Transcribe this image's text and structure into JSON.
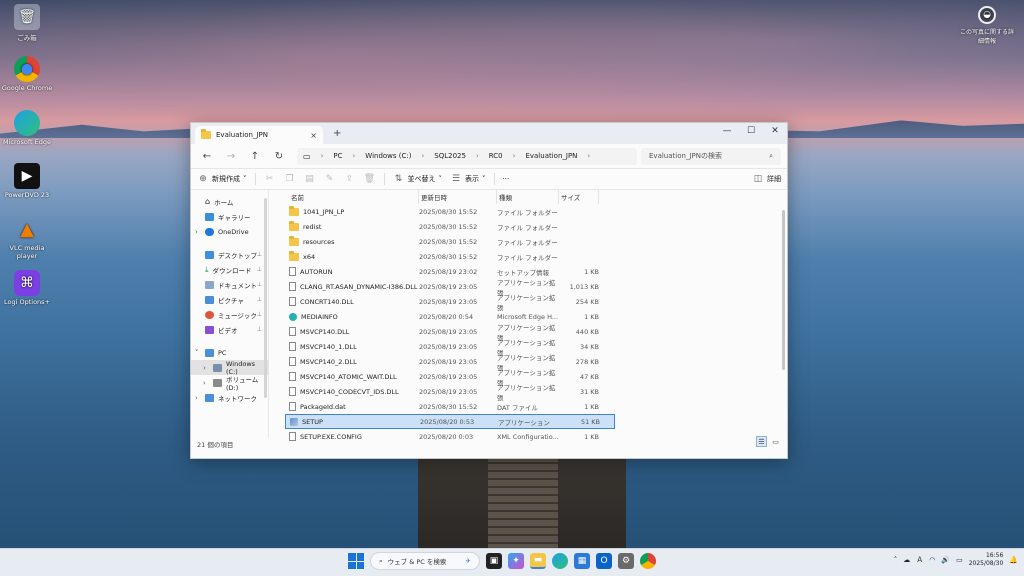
{
  "desktop": {
    "icons": [
      {
        "label": "ごみ箱",
        "glyph": "🗑"
      },
      {
        "label": "Google Chrome",
        "glyph": "◉"
      },
      {
        "label": "Microsoft Edge",
        "glyph": "◔"
      },
      {
        "label": "PowerDVD 23",
        "glyph": "▶"
      },
      {
        "label": "VLC media player",
        "glyph": "▲"
      },
      {
        "label": "Logi Options+",
        "glyph": "⌘"
      }
    ],
    "widget_label": "この写真に関する詳細情報"
  },
  "window": {
    "tab_title": "Evaluation_JPN",
    "tab_close": "×",
    "tab_add": "+",
    "controls": {
      "minimize": "—",
      "maximize": "☐",
      "close": "✕"
    },
    "nav": {
      "back": "←",
      "forward": "→",
      "up": "↑",
      "refresh": "↻"
    },
    "breadcrumb": [
      "PC",
      "Windows (C:)",
      "SQL2025",
      "RC0",
      "Evaluation_JPN"
    ],
    "search_placeholder": "Evaluation_JPNの検索",
    "toolbar": {
      "new": "新規作成",
      "sort": "並べ替え",
      "view": "表示",
      "more": "···",
      "details": "詳細"
    },
    "sidebar": {
      "home": "ホーム",
      "gallery": "ギャラリー",
      "onedrive": "OneDrive",
      "desktop": "デスクトップ",
      "downloads": "ダウンロード",
      "documents": "ドキュメント",
      "pictures": "ピクチャ",
      "music": "ミュージック",
      "videos": "ビデオ",
      "pc": "PC",
      "windows_c": "Windows (C:)",
      "volume_d": "ボリューム (D:)",
      "network": "ネットワーク"
    },
    "columns": {
      "name": "名前",
      "date": "更新日時",
      "type": "種類",
      "size": "サイズ"
    },
    "files": [
      {
        "name": "1041_JPN_LP",
        "date": "2025/08/30 15:52",
        "type": "ファイル フォルダー",
        "size": "",
        "kind": "folder"
      },
      {
        "name": "redist",
        "date": "2025/08/30 15:52",
        "type": "ファイル フォルダー",
        "size": "",
        "kind": "folder"
      },
      {
        "name": "resources",
        "date": "2025/08/30 15:52",
        "type": "ファイル フォルダー",
        "size": "",
        "kind": "folder"
      },
      {
        "name": "x64",
        "date": "2025/08/30 15:52",
        "type": "ファイル フォルダー",
        "size": "",
        "kind": "folder"
      },
      {
        "name": "AUTORUN",
        "date": "2025/08/19 23:02",
        "type": "セットアップ情報",
        "size": "1 KB",
        "kind": "file"
      },
      {
        "name": "CLANG_RT.ASAN_DYNAMIC-I386.DLL",
        "date": "2025/08/19 23:05",
        "type": "アプリケーション拡張",
        "size": "1,013 KB",
        "kind": "file"
      },
      {
        "name": "CONCRT140.DLL",
        "date": "2025/08/19 23:05",
        "type": "アプリケーション拡張",
        "size": "254 KB",
        "kind": "file"
      },
      {
        "name": "MEDIAINFO",
        "date": "2025/08/20 0:54",
        "type": "Microsoft Edge H...",
        "size": "1 KB",
        "kind": "edge"
      },
      {
        "name": "MSVCP140.DLL",
        "date": "2025/08/19 23:05",
        "type": "アプリケーション拡張",
        "size": "440 KB",
        "kind": "file"
      },
      {
        "name": "MSVCP140_1.DLL",
        "date": "2025/08/19 23:05",
        "type": "アプリケーション拡張",
        "size": "34 KB",
        "kind": "file"
      },
      {
        "name": "MSVCP140_2.DLL",
        "date": "2025/08/19 23:05",
        "type": "アプリケーション拡張",
        "size": "278 KB",
        "kind": "file"
      },
      {
        "name": "MSVCP140_ATOMIC_WAIT.DLL",
        "date": "2025/08/19 23:05",
        "type": "アプリケーション拡張",
        "size": "47 KB",
        "kind": "file"
      },
      {
        "name": "MSVCP140_CODECVT_IDS.DLL",
        "date": "2025/08/19 23:05",
        "type": "アプリケーション拡張",
        "size": "31 KB",
        "kind": "file"
      },
      {
        "name": "PackageId.dat",
        "date": "2025/08/30 15:52",
        "type": "DAT ファイル",
        "size": "1 KB",
        "kind": "file"
      },
      {
        "name": "SETUP",
        "date": "2025/08/20 0:53",
        "type": "アプリケーション",
        "size": "51 KB",
        "kind": "setup",
        "selected": true
      },
      {
        "name": "SETUP.EXE.CONFIG",
        "date": "2025/08/20 0:03",
        "type": "XML Configuratio...",
        "size": "1 KB",
        "kind": "file"
      }
    ],
    "status": "21 個の項目"
  },
  "taskbar": {
    "search_placeholder": "ウェブ & PC を検索",
    "time": "16:56",
    "date": "2025/08/30"
  },
  "colors": {
    "accent": "#3d84d6",
    "selection": "#cce0f7",
    "folder": "#f3c64a"
  }
}
